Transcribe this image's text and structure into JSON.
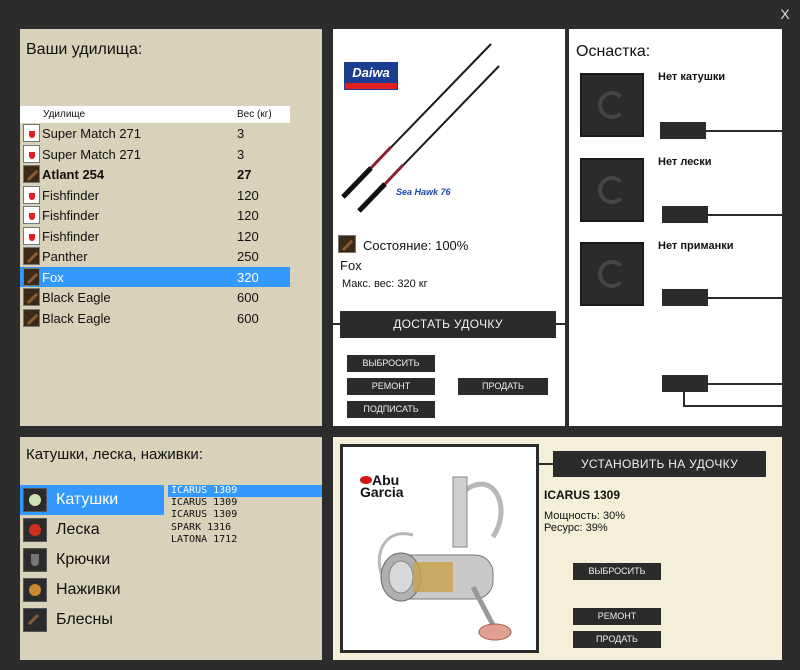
{
  "window": {
    "close_label": "X"
  },
  "rods": {
    "title": "Ваши удилища:",
    "columns": [
      "Удилище",
      "Вес (кг)"
    ],
    "items": [
      {
        "name": "Super Match 271",
        "weight": "3",
        "icon": "float-icon",
        "selected": false,
        "bold": false
      },
      {
        "name": "Super Match 271",
        "weight": "3",
        "icon": "float-icon",
        "selected": false,
        "bold": false
      },
      {
        "name": "Atlant 254",
        "weight": "27",
        "icon": "feather-icon",
        "selected": false,
        "bold": true
      },
      {
        "name": "Fishfinder",
        "weight": "120",
        "icon": "float-icon",
        "selected": false,
        "bold": false
      },
      {
        "name": "Fishfinder",
        "weight": "120",
        "icon": "float-icon",
        "selected": false,
        "bold": false
      },
      {
        "name": "Fishfinder",
        "weight": "120",
        "icon": "float-icon",
        "selected": false,
        "bold": false
      },
      {
        "name": "Panther",
        "weight": "250",
        "icon": "feather-icon",
        "selected": false,
        "bold": false
      },
      {
        "name": "Fox",
        "weight": "320",
        "icon": "feather-icon",
        "selected": true,
        "bold": false
      },
      {
        "name": "Black Eagle",
        "weight": "600",
        "icon": "feather-icon",
        "selected": false,
        "bold": false
      },
      {
        "name": "Black Eagle",
        "weight": "600",
        "icon": "feather-icon",
        "selected": false,
        "bold": false
      }
    ]
  },
  "rod_detail": {
    "brand": "Daiwa",
    "model_caption": "Sea Hawk 76",
    "state": "Состояние: 100%",
    "name": "Fox",
    "max_weight": "Макс. вес: 320 кг",
    "get_button": "ДОСТАТЬ УДОЧКУ",
    "throw_button": "ВЫБРОСИТЬ",
    "repair_button": "РЕМОНТ",
    "sign_button": "ПОДПИСАТЬ",
    "sell_button": "ПРОДАТЬ"
  },
  "tackle": {
    "title": "Оснастка:",
    "no_reel": "Нет катушки",
    "no_line": "Нет лески",
    "no_lure": "Нет приманки"
  },
  "items": {
    "title": "Катушки, леска, наживки:",
    "categories": [
      {
        "label": "Катушки",
        "selected": true
      },
      {
        "label": "Леска",
        "selected": false
      },
      {
        "label": "Крючки",
        "selected": false
      },
      {
        "label": "Наживки",
        "selected": false
      },
      {
        "label": "Блесны",
        "selected": false
      }
    ],
    "reels": [
      {
        "name": "ICARUS 1309",
        "selected": true
      },
      {
        "name": "ICARUS 1309",
        "selected": false
      },
      {
        "name": "ICARUS 1309",
        "selected": false
      },
      {
        "name": "SPARK 1316",
        "selected": false
      },
      {
        "name": "LATONA 1712",
        "selected": false
      }
    ]
  },
  "reel_detail": {
    "brand_line1": "Abu",
    "brand_line2": "Garcia",
    "name": "ICARUS 1309",
    "power": "Мощность: 30%",
    "resource": "Ресурс: 39%",
    "install_button": "УСТАНОВИТЬ НА УДОЧКУ",
    "throw_button": "ВЫБРОСИТЬ",
    "repair_button": "РЕМОНТ",
    "sell_button": "ПРОДАТЬ"
  },
  "colors": {
    "selection": "#3399ff",
    "panel_beige": "#d7d2b9",
    "panel_cream": "#f3efd9",
    "frame_dark": "#2c2c2c",
    "button_dark": "#2b2b2b"
  }
}
